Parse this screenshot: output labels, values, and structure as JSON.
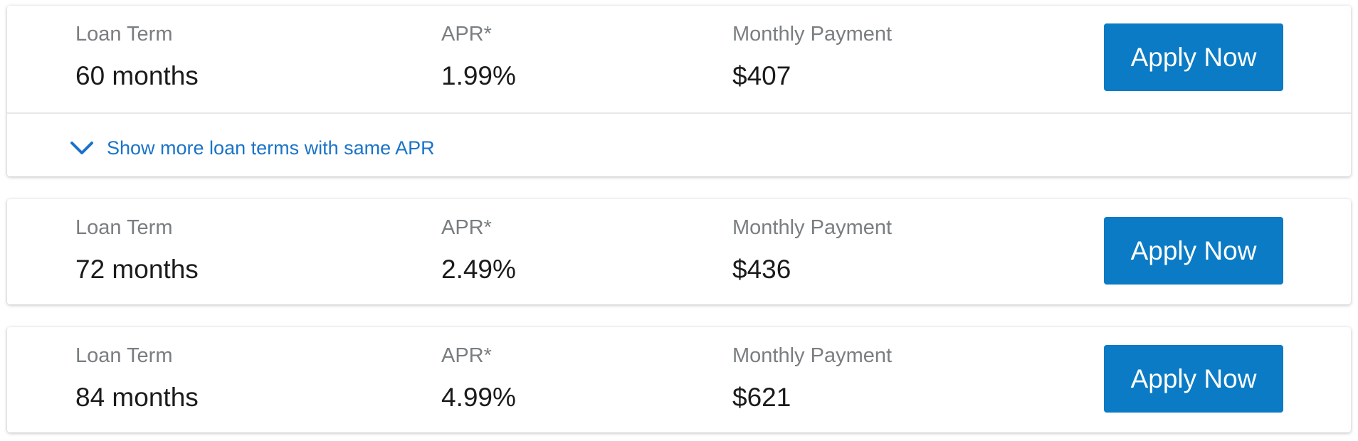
{
  "offers": [
    {
      "term_label": "Loan Term",
      "term_value": "60 months",
      "apr_label": "APR*",
      "apr_value": "1.99%",
      "payment_label": "Monthly Payment",
      "payment_value": "$407",
      "apply_label": "Apply Now",
      "more_link": "Show more loan terms with same APR"
    },
    {
      "term_label": "Loan Term",
      "term_value": "72 months",
      "apr_label": "APR*",
      "apr_value": "2.49%",
      "payment_label": "Monthly Payment",
      "payment_value": "$436",
      "apply_label": "Apply Now"
    },
    {
      "term_label": "Loan Term",
      "term_value": "84 months",
      "apr_label": "APR*",
      "apr_value": "4.99%",
      "payment_label": "Monthly Payment",
      "payment_value": "$621",
      "apply_label": "Apply Now"
    }
  ],
  "icons": {
    "expand": "chevron-down-icon"
  },
  "colors": {
    "accent": "#0a7bc4",
    "link": "#1a73c9",
    "label": "#7a7e81",
    "value": "#1b1b1b"
  }
}
